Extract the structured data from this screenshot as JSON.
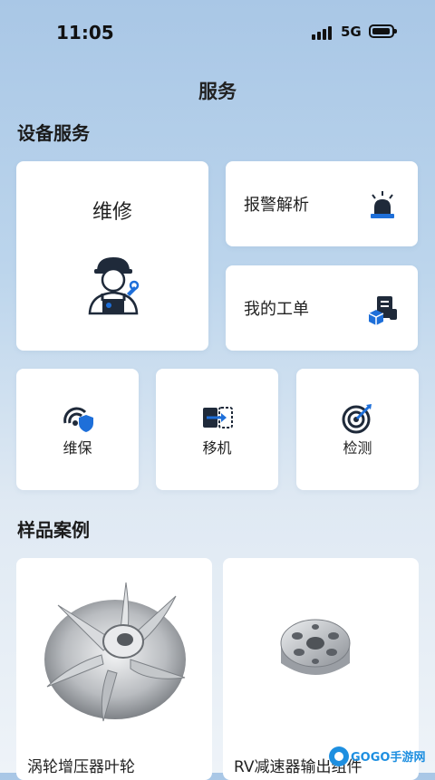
{
  "status": {
    "time": "11:05",
    "network": "5G"
  },
  "page_title": "服务",
  "equipment_section": {
    "title": "设备服务",
    "repair_label": "维修",
    "alarm_label": "报警解析",
    "orders_label": "我的工单",
    "maintenance_label": "维保",
    "relocate_label": "移机",
    "inspect_label": "检测"
  },
  "samples_section": {
    "title": "样品案例",
    "items": [
      {
        "name": "涡轮增压器叶轮"
      },
      {
        "name": "RV减速器输出组件"
      }
    ]
  },
  "watermark": {
    "text": "GOGO手游网"
  },
  "colors": {
    "accent_blue": "#1e6fd9",
    "dark_icon": "#1f2a3a"
  }
}
